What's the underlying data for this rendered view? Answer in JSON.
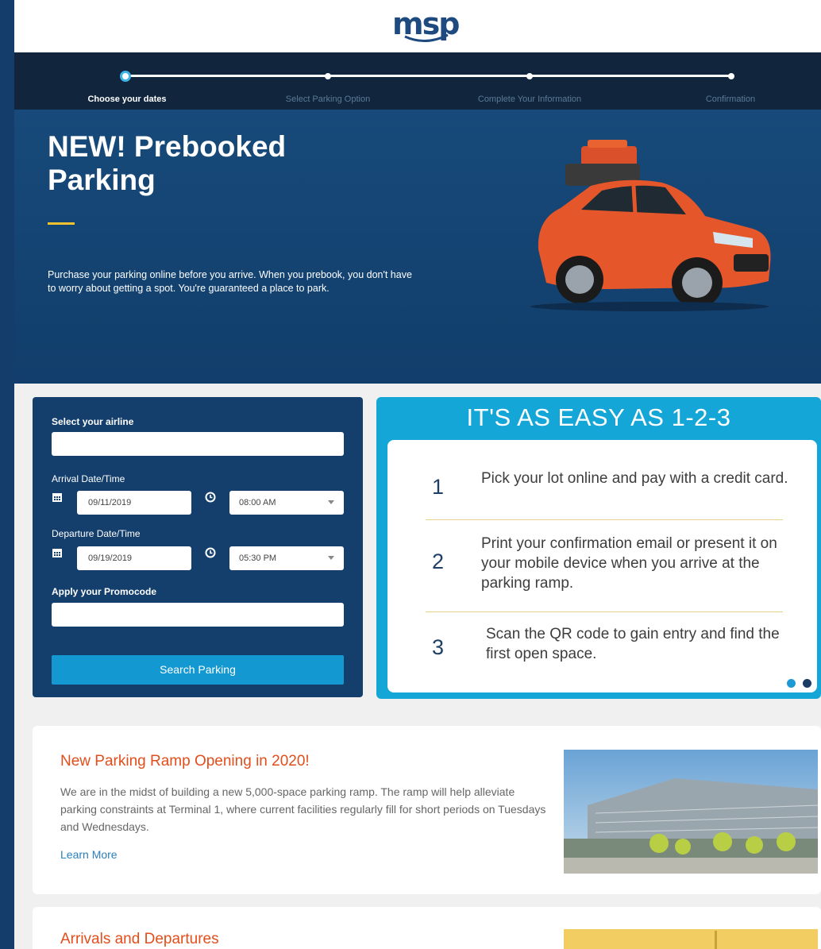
{
  "brand": {
    "logo_text": "msp"
  },
  "stepper": {
    "steps": [
      {
        "label": "Choose your dates",
        "active": true
      },
      {
        "label": "Select Parking Option",
        "active": false
      },
      {
        "label": "Complete Your Information",
        "active": false
      },
      {
        "label": "Confirmation",
        "active": false
      }
    ]
  },
  "hero": {
    "title": "NEW! Prebooked Parking",
    "description": "Purchase your parking online before you arrive. When you prebook, you don't have to worry about getting a spot. You're guaranteed a place to park."
  },
  "booking_form": {
    "airline_label": "Select your airline",
    "airline_value": "",
    "arrival_label": "Arrival Date/Time",
    "arrival_date": "09/11/2019",
    "arrival_time": "08:00 AM",
    "departure_label": "Departure Date/Time",
    "departure_date": "09/19/2019",
    "departure_time": "05:30 PM",
    "promo_label": "Apply your Promocode",
    "promo_value": "",
    "search_label": "Search Parking"
  },
  "easy_steps": {
    "title": "IT'S AS EASY AS 1-2-3",
    "items": [
      {
        "number": "1",
        "text": "Pick your lot online and pay with a credit card."
      },
      {
        "number": "2",
        "text": "Print your confirmation email or present it on your mobile device when you arrive at the parking ramp."
      },
      {
        "number": "3",
        "text": "Scan the QR code to gain entry and find the first open space."
      }
    ],
    "carousel_active_index": 1,
    "carousel_count": 2
  },
  "news": [
    {
      "title": "New Parking Ramp Opening in 2020!",
      "description": "We are in the midst of building a new 5,000-space parking ramp. The ramp will help alleviate parking constraints at Terminal 1, where current facilities regularly fill for short periods on Tuesdays and Wednesdays.",
      "link": "Learn More"
    },
    {
      "title": "Arrivals and Departures"
    }
  ],
  "colors": {
    "navy": "#143f6c",
    "accent_blue": "#14a6d6",
    "orange_title": "#e24e1b",
    "gold_rule": "#f2c230"
  },
  "icons": {
    "calendar": "calendar-icon",
    "clock": "clock-icon",
    "caret": "chevron-down-icon"
  }
}
